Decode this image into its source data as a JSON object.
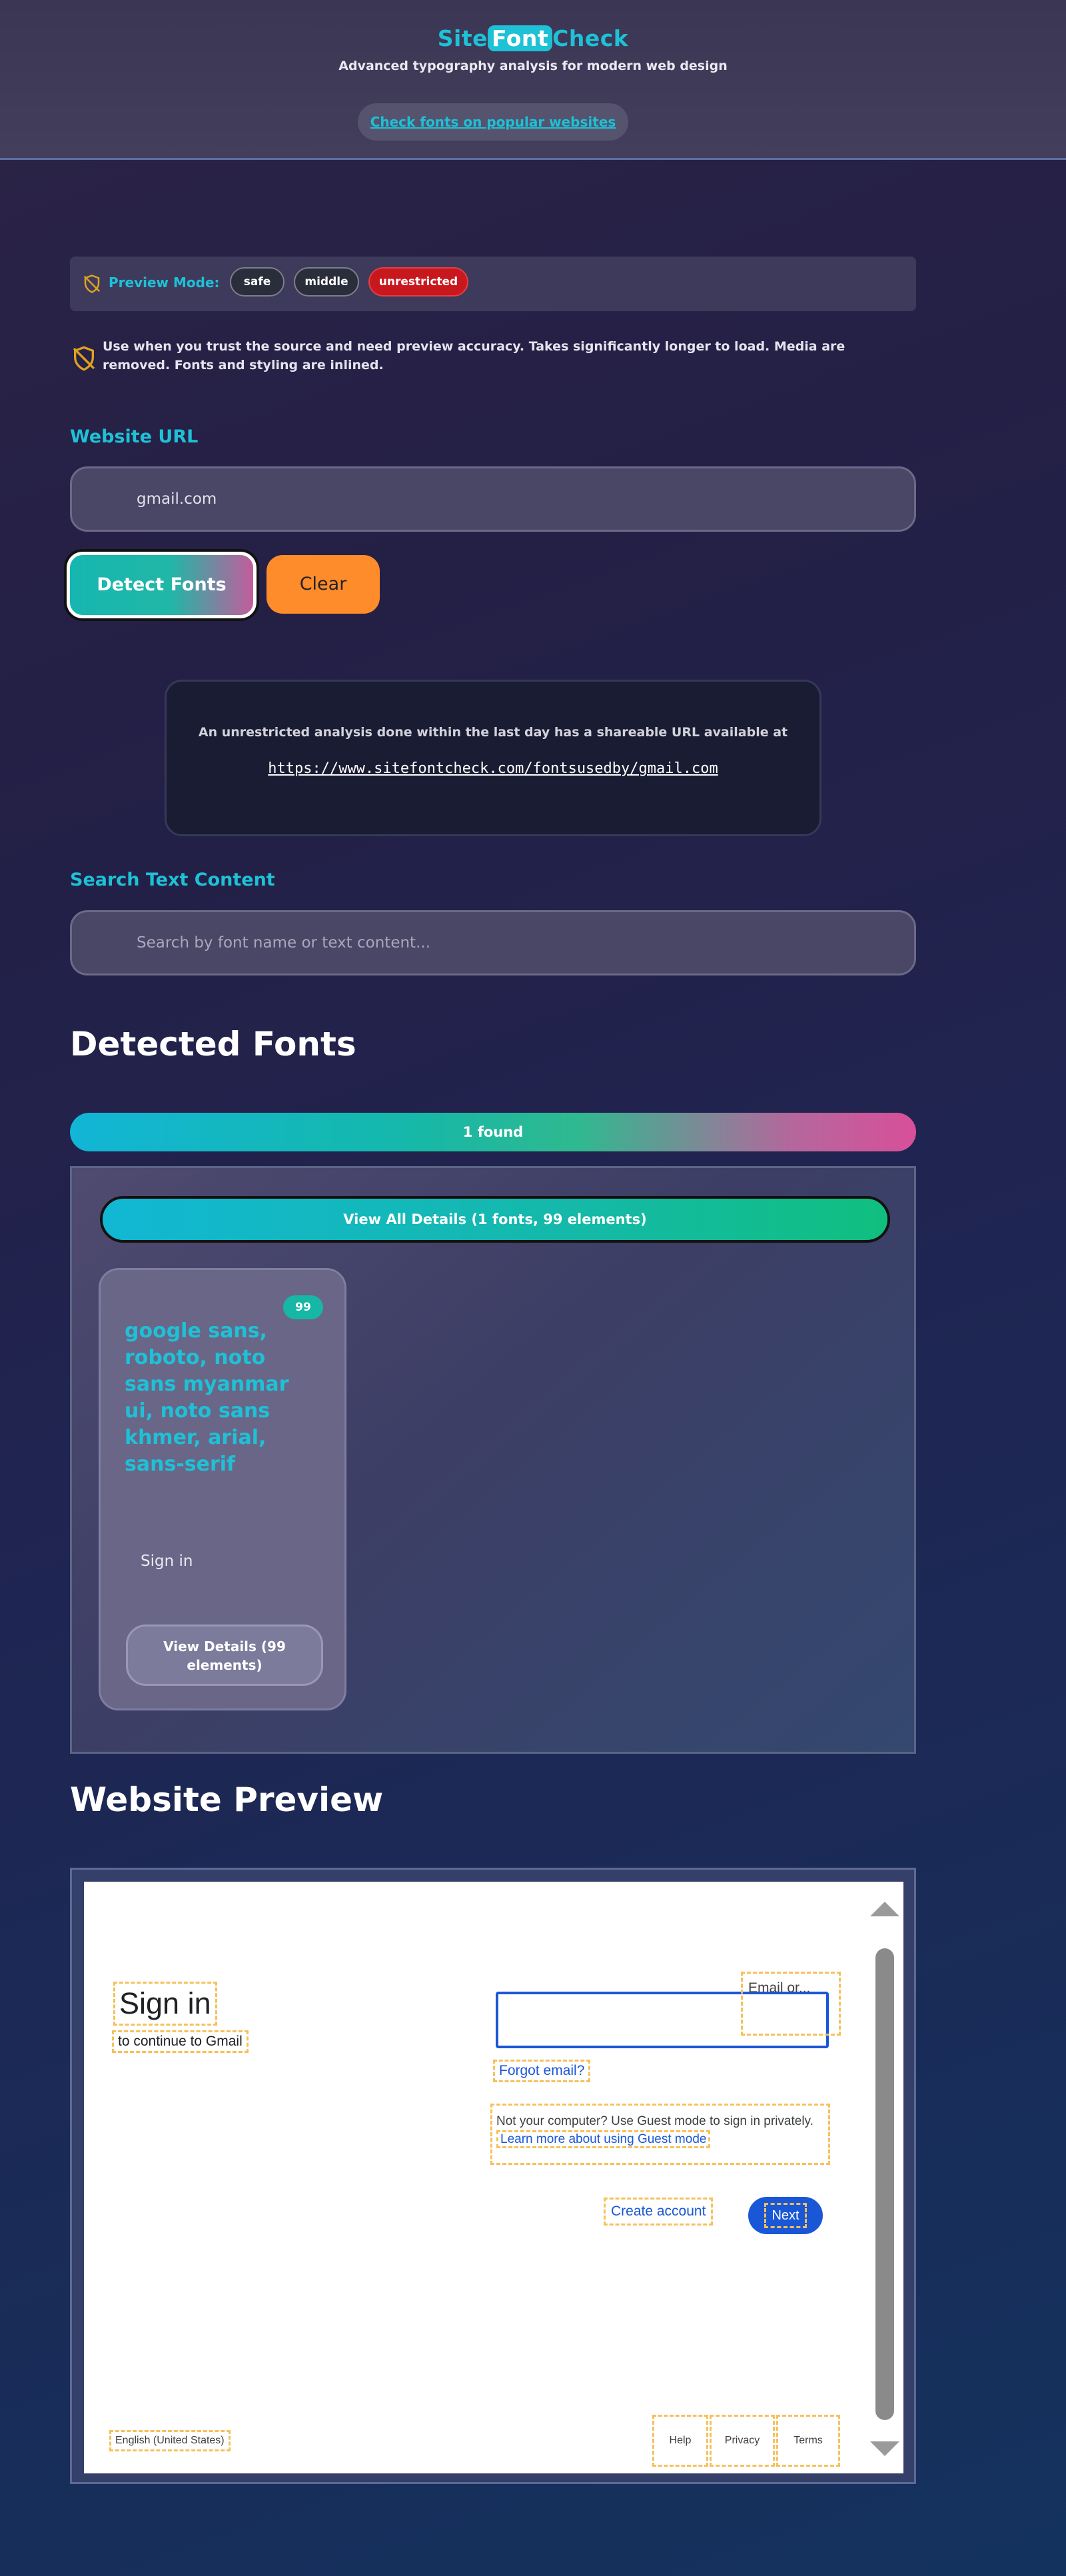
{
  "header": {
    "brand_pre": "Site",
    "brand_mid": "Font",
    "brand_post": "Check",
    "tagline": "Advanced typography analysis for modern web design",
    "popular_link": "Check fonts on popular websites"
  },
  "preview_mode": {
    "label": "Preview Mode:",
    "options": [
      "safe",
      "middle",
      "unrestricted"
    ],
    "selected": "unrestricted",
    "note": "Use when you trust the source and need preview accuracy. Takes significantly longer to load. Media are removed. Fonts and styling are inlined."
  },
  "url_section": {
    "label": "Website URL",
    "value": "gmail.com",
    "detect_label": "Detect Fonts",
    "clear_label": "Clear"
  },
  "share": {
    "text": "An unrestricted analysis done within the last day has a shareable URL available at",
    "url": "https://www.sitefontcheck.com/fontsusedby/gmail.com"
  },
  "search": {
    "label": "Search Text Content",
    "placeholder": "Search by font name or text content..."
  },
  "detected": {
    "title": "Detected Fonts",
    "found_label": "1 found",
    "view_all_label": "View All Details (1 fonts, 99 elements)",
    "cards": [
      {
        "count": "99",
        "font_name": "google sans, roboto, noto sans myanmar ui, noto sans khmer, arial, sans-serif",
        "sample": "Sign in",
        "details_label": "View Details (99 elements)"
      }
    ]
  },
  "preview": {
    "title": "Website Preview",
    "signin_title": "Sign in",
    "signin_sub": "to continue to Gmail",
    "email_label": "Email or...",
    "forgot": "Forgot email?",
    "guest_text": "Not your computer? Use Guest mode to sign in privately.",
    "guest_link": "Learn more about using Guest mode",
    "create": "Create account",
    "next": "Next",
    "language": "English (United States)",
    "footer": [
      "Help",
      "Privacy",
      "Terms"
    ]
  },
  "colors": {
    "accent": "#1ec1d6",
    "danger": "#c8181d",
    "orange": "#ff8c2b",
    "link_blue": "#1a57d6"
  }
}
